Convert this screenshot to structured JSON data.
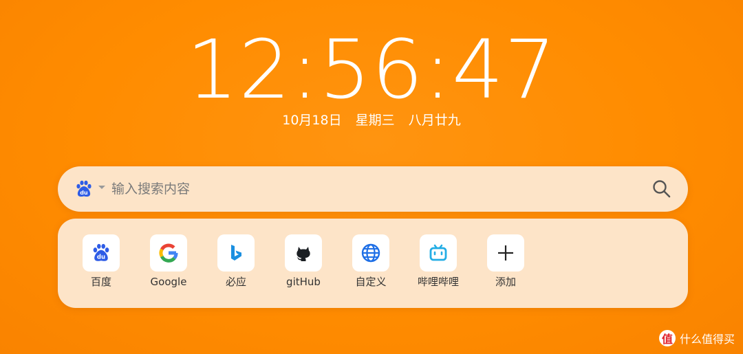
{
  "clock": {
    "time": "12:56:47",
    "date": "10月18日",
    "weekday": "星期三",
    "lunar_date": "八月廿九"
  },
  "search": {
    "placeholder": "输入搜索内容",
    "engine": "baidu",
    "engine_icon": "baidu-paw-icon",
    "submit_icon": "search-icon"
  },
  "shortcuts": [
    {
      "label": "百度",
      "icon": "baidu-icon"
    },
    {
      "label": "Google",
      "icon": "google-icon"
    },
    {
      "label": "必应",
      "icon": "bing-icon"
    },
    {
      "label": "gitHub",
      "icon": "github-icon"
    },
    {
      "label": "自定义",
      "icon": "globe-icon"
    },
    {
      "label": "哔哩哔哩",
      "icon": "bilibili-icon"
    },
    {
      "label": "添加",
      "icon": "plus-icon"
    }
  ],
  "watermark": {
    "badge": "值",
    "text": "什么值得买"
  },
  "colors": {
    "background": "#ff8c00",
    "panel": "#fde4c8",
    "baidu_blue": "#2e5ce6",
    "bing_blue": "#1a8fe0",
    "bilibili_blue": "#23ade5"
  }
}
